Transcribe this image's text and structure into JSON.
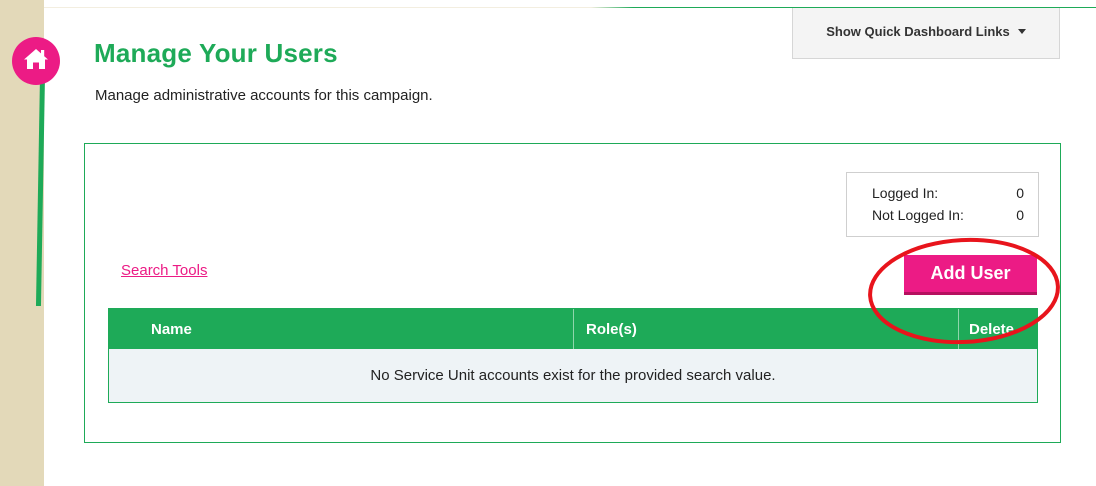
{
  "header": {
    "title": "Manage Your Users",
    "subtitle": "Manage administrative accounts for this campaign.",
    "quick_links_label": "Show Quick Dashboard Links",
    "home_icon": "home-icon"
  },
  "stats": {
    "logged_in_label": "Logged In:",
    "logged_in_value": "0",
    "not_logged_in_label": "Not Logged In:",
    "not_logged_in_value": "0"
  },
  "toolbar": {
    "search_tools_label": "Search Tools",
    "add_user_label": "Add User"
  },
  "table": {
    "columns": [
      "Name",
      "Role(s)",
      "Delete"
    ],
    "empty_message": "No Service Unit accounts exist for the provided search value."
  },
  "colors": {
    "brand_green": "#1eaa58",
    "brand_pink": "#ec1b85",
    "sidebar_tan": "#e3d9b9",
    "annotation_red": "#e8141c"
  }
}
